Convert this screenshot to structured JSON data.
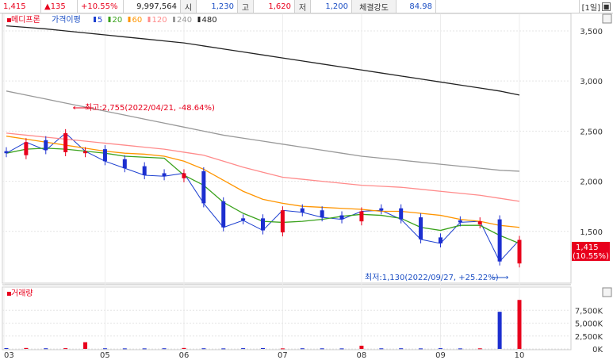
{
  "topbar": {
    "price": "1,415",
    "change": "▲135",
    "change_pct": "+10.55%",
    "volume": "9,997,564",
    "open_label": "시",
    "open": "1,230",
    "high_label": "고",
    "high": "1,620",
    "low_label": "저",
    "low": "1,200",
    "strength_label": "체결강도",
    "strength": "84.98",
    "period": "[1일]"
  },
  "legend": {
    "stock": "메디프론",
    "ma_title": "가격이평",
    "ma": [
      {
        "label": "5",
        "color": "#1c3fd0"
      },
      {
        "label": "20",
        "color": "#3aa21c"
      },
      {
        "label": "60",
        "color": "#ff9500"
      },
      {
        "label": "120",
        "color": "#ff8b8b"
      },
      {
        "label": "240",
        "color": "#999999"
      },
      {
        "label": "480",
        "color": "#222222"
      }
    ]
  },
  "price_axis": [
    "3,500",
    "3,000",
    "2,500",
    "2,000",
    "1,500"
  ],
  "current_price_tag": [
    "1,415",
    "(10.55%)"
  ],
  "annotations": {
    "high": "최고:2,755(2022/04/21, -48.64%)",
    "low": "최저:1,130(2022/09/27, +25.22%)"
  },
  "volume_panel": {
    "title": "거래량",
    "axis": [
      "7,500K",
      "5,000K",
      "2,500K",
      "0K"
    ]
  },
  "x_axis": [
    "03",
    "05",
    "06",
    "07",
    "08",
    "09",
    "10"
  ],
  "colors": {
    "up": "#e8001c",
    "down": "#1c2fd0",
    "ma5": "#1c3fd0",
    "ma20": "#3aa21c",
    "ma60": "#ff9500",
    "ma120": "#ff8b8b",
    "ma240": "#999999",
    "ma480": "#222222"
  },
  "chart_data": {
    "type": "line",
    "ylim": [
      1000,
      3650
    ],
    "x": [
      "2022-03-31",
      "2022-04-08",
      "2022-04-15",
      "2022-04-21",
      "2022-04-28",
      "2022-05-06",
      "2022-05-13",
      "2022-05-20",
      "2022-05-27",
      "2022-06-03",
      "2022-06-10",
      "2022-06-17",
      "2022-06-24",
      "2022-07-01",
      "2022-07-08",
      "2022-07-15",
      "2022-07-22",
      "2022-07-29",
      "2022-08-05",
      "2022-08-12",
      "2022-08-19",
      "2022-08-26",
      "2022-09-02",
      "2022-09-09",
      "2022-09-16",
      "2022-09-23",
      "2022-09-30"
    ],
    "series": [
      {
        "name": "5",
        "values": [
          2280,
          2390,
          2310,
          2480,
          2300,
          2200,
          2130,
          2060,
          2050,
          2080,
          1780,
          1540,
          1610,
          1510,
          1710,
          1690,
          1640,
          1620,
          1700,
          1710,
          1620,
          1420,
          1380,
          1590,
          1600,
          1200,
          1415
        ]
      },
      {
        "name": "20",
        "values": [
          2280,
          2320,
          2330,
          2320,
          2300,
          2280,
          2250,
          2240,
          2230,
          2060,
          1960,
          1790,
          1680,
          1600,
          1590,
          1600,
          1620,
          1650,
          1670,
          1660,
          1630,
          1540,
          1510,
          1560,
          1560,
          1460,
          1380
        ]
      },
      {
        "name": "60",
        "values": [
          2450,
          2420,
          2390,
          2360,
          2330,
          2300,
          2280,
          2270,
          2250,
          2200,
          2120,
          2010,
          1900,
          1820,
          1780,
          1750,
          1740,
          1730,
          1720,
          1700,
          1700,
          1680,
          1660,
          1620,
          1600,
          1560,
          1540
        ]
      },
      {
        "name": "120",
        "values": [
          2480,
          2460,
          2440,
          2420,
          2400,
          2380,
          2360,
          2340,
          2320,
          2290,
          2260,
          2200,
          2140,
          2090,
          2040,
          2020,
          2000,
          1980,
          1960,
          1950,
          1940,
          1920,
          1900,
          1880,
          1860,
          1830,
          1800
        ]
      },
      {
        "name": "240",
        "values": [
          2900,
          2860,
          2820,
          2780,
          2740,
          2700,
          2660,
          2620,
          2580,
          2540,
          2500,
          2460,
          2430,
          2400,
          2370,
          2340,
          2310,
          2280,
          2250,
          2230,
          2210,
          2190,
          2170,
          2150,
          2130,
          2110,
          2100
        ]
      },
      {
        "name": "480",
        "values": [
          3550,
          3535,
          3520,
          3500,
          3480,
          3460,
          3440,
          3420,
          3400,
          3380,
          3350,
          3320,
          3290,
          3260,
          3230,
          3200,
          3170,
          3140,
          3110,
          3080,
          3050,
          3020,
          2990,
          2960,
          2930,
          2900,
          2860
        ]
      }
    ],
    "volume": {
      "ylim": [
        0,
        10000
      ],
      "values": [
        150,
        180,
        120,
        140,
        1300,
        120,
        100,
        100,
        120,
        180,
        120,
        100,
        140,
        160,
        100,
        120,
        110,
        100,
        620,
        110,
        120,
        100,
        140,
        100,
        110,
        7200,
        9500
      ],
      "up": [
        false,
        true,
        false,
        true,
        true,
        false,
        false,
        false,
        false,
        true,
        false,
        false,
        false,
        false,
        true,
        false,
        false,
        false,
        true,
        false,
        false,
        false,
        false,
        false,
        true,
        false,
        true
      ]
    }
  }
}
